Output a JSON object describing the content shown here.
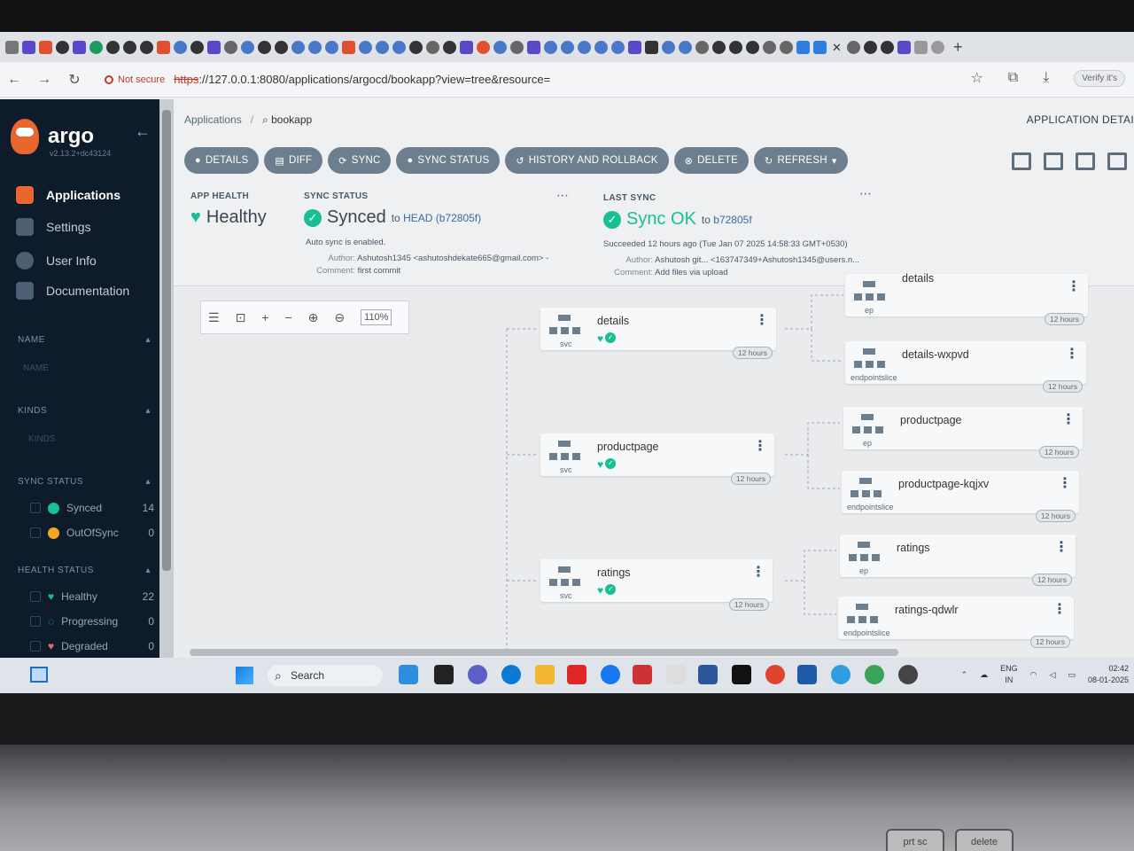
{
  "browser": {
    "security_label": "Not secure",
    "url_protocol": "https",
    "url_rest": "://127.0.0.1:8080/applications/argocd/bookapp?view=tree&resource=",
    "verify_label": "Verify it's"
  },
  "sidebar": {
    "logo": "argo",
    "version": "v2.13.2+dc43124",
    "nav": [
      {
        "label": "Applications"
      },
      {
        "label": "Settings"
      },
      {
        "label": "User Info"
      },
      {
        "label": "Documentation"
      }
    ],
    "filters": {
      "name_title": "NAME",
      "name_placeholder": "NAME",
      "kinds_title": "KINDS",
      "kinds_placeholder": "KINDS",
      "sync_title": "SYNC STATUS",
      "sync": [
        {
          "label": "Synced",
          "count": "14"
        },
        {
          "label": "OutOfSync",
          "count": "0"
        }
      ],
      "health_title": "HEALTH STATUS",
      "health": [
        {
          "label": "Healthy",
          "count": "22"
        },
        {
          "label": "Progressing",
          "count": "0"
        },
        {
          "label": "Degraded",
          "count": "0"
        }
      ]
    }
  },
  "main": {
    "breadcrumb_root": "Applications",
    "breadcrumb_current": "bookapp",
    "page_heading": "APPLICATION DETAI",
    "actions": [
      {
        "label": "DETAILS"
      },
      {
        "label": "DIFF"
      },
      {
        "label": "SYNC"
      },
      {
        "label": "SYNC STATUS"
      },
      {
        "label": "HISTORY AND ROLLBACK"
      },
      {
        "label": "DELETE"
      },
      {
        "label": "REFRESH"
      }
    ],
    "app_health": {
      "title": "APP HEALTH",
      "value": "Healthy"
    },
    "sync_status": {
      "title": "SYNC STATUS",
      "value": "Synced",
      "to_prefix": "to",
      "to_target": "HEAD (b72805f)",
      "auto_sync": "Auto sync is enabled.",
      "author_label": "Author:",
      "author": "Ashutosh1345 <ashutoshdekate665@gmail.com> -",
      "comment_label": "Comment:",
      "comment": "first commit"
    },
    "last_sync": {
      "title": "LAST SYNC",
      "value": "Sync OK",
      "to_prefix": "to",
      "to_target": "b72805f",
      "succeeded": "Succeeded 12 hours ago (Tue Jan 07 2025 14:58:33 GMT+0530)",
      "author_label": "Author:",
      "author": "Ashutosh git... <163747349+Ashutosh1345@users.n...",
      "comment_label": "Comment:",
      "comment": "Add files via upload"
    },
    "zoom": "110%",
    "nodes": [
      {
        "name": "details",
        "type": "svc",
        "age": "12 hours"
      },
      {
        "name": "productpage",
        "type": "svc",
        "age": "12 hours"
      },
      {
        "name": "ratings",
        "type": "svc",
        "age": "12 hours"
      },
      {
        "name": "details",
        "type": "ep",
        "age": "12 hours"
      },
      {
        "name": "details-wxpvd",
        "type": "endpointslice",
        "age": "12 hours"
      },
      {
        "name": "productpage",
        "type": "ep",
        "age": "12 hours"
      },
      {
        "name": "productpage-kqjxv",
        "type": "endpointslice",
        "age": "12 hours"
      },
      {
        "name": "ratings",
        "type": "ep",
        "age": "12 hours"
      },
      {
        "name": "ratings-qdwlr",
        "type": "endpointslice",
        "age": "12 hours"
      }
    ]
  },
  "taskbar": {
    "search": "Search",
    "lang": "ENG",
    "region": "IN",
    "time": "02:42",
    "date": "08-01-2025"
  },
  "keyboard": {
    "keys": [
      "prt sc",
      "delete"
    ]
  },
  "colors": {
    "sidebar_bg": "#0d1b2a",
    "accent_green": "#18be94",
    "button_bg": "#6d7f8e",
    "argo_orange": "#e9662f"
  }
}
